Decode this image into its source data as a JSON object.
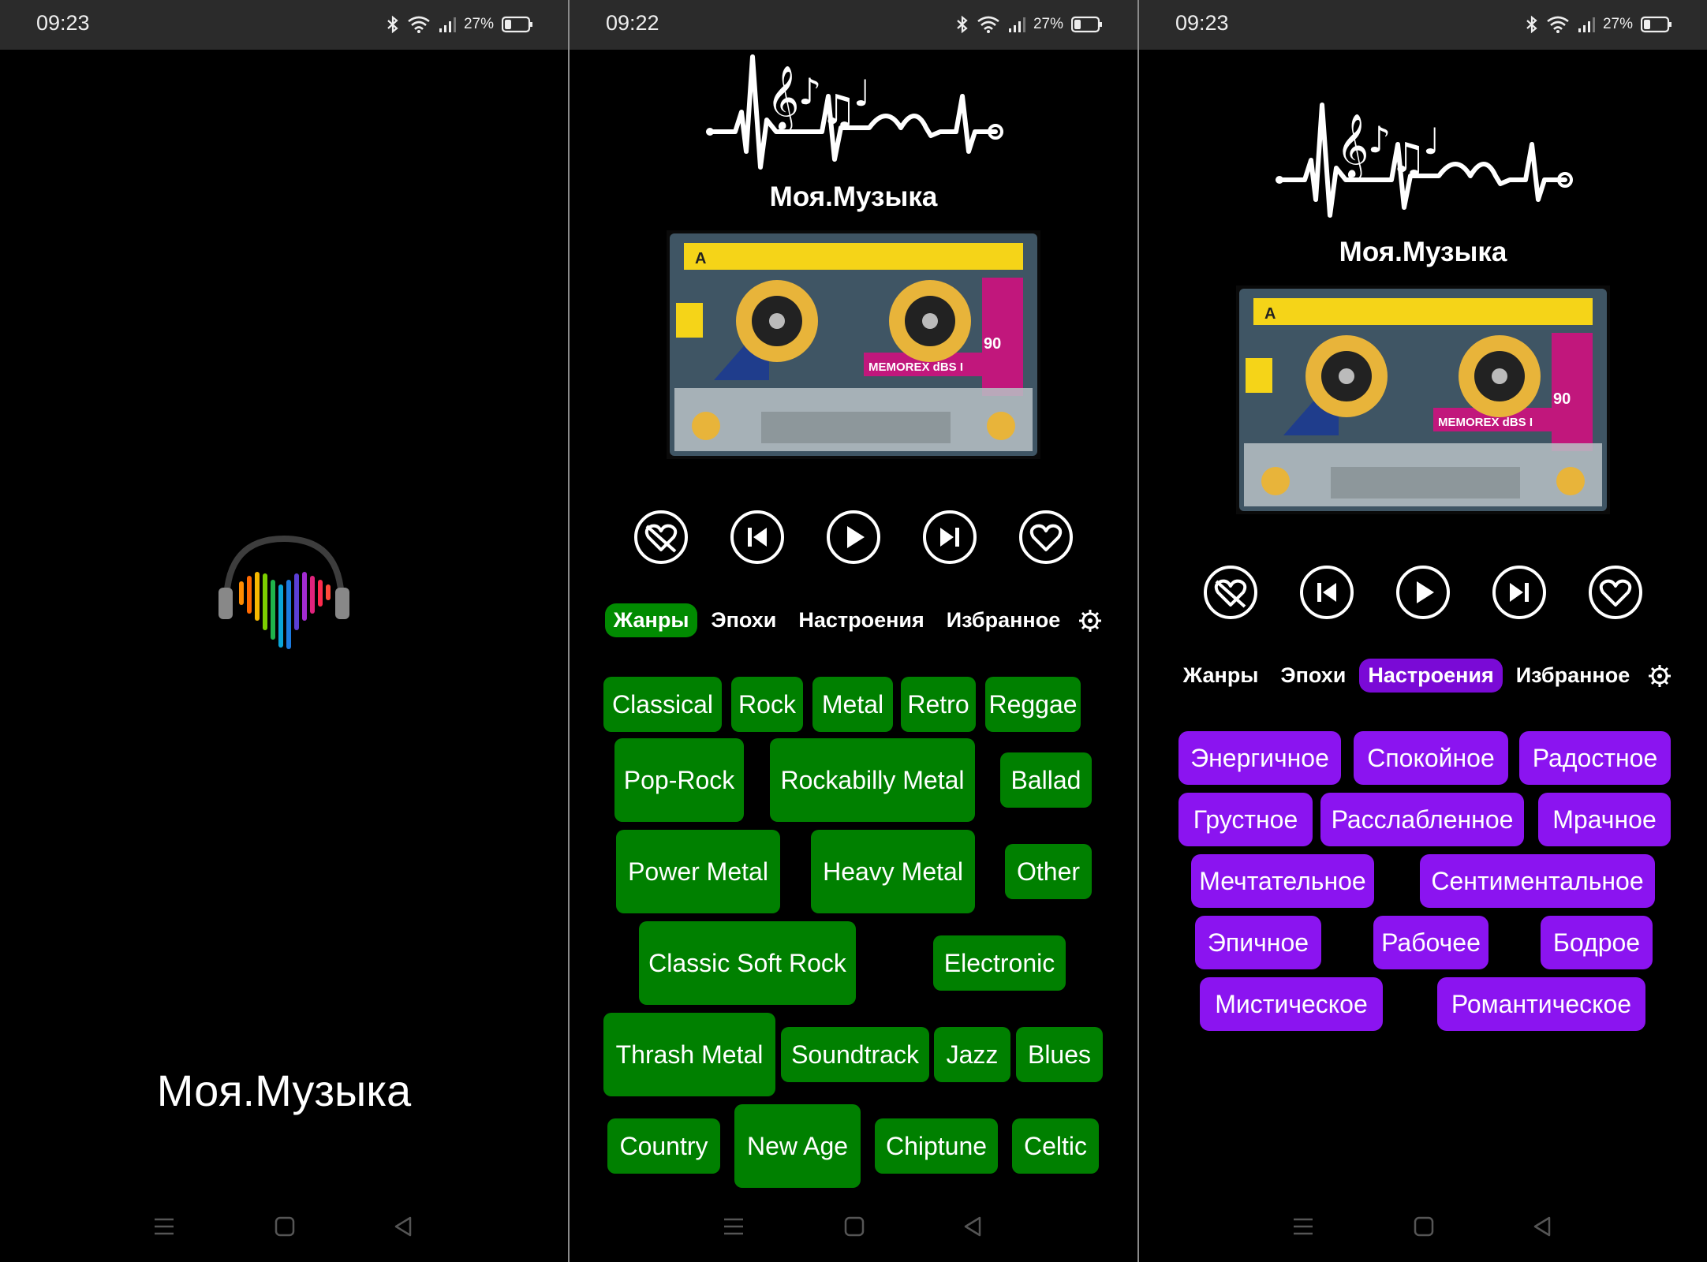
{
  "status": {
    "s1_time": "09:23",
    "s2_time": "09:22",
    "s3_time": "09:23",
    "battery": "27%"
  },
  "splash": {
    "title": "Моя.Музыка"
  },
  "app": {
    "title": "Моя.Музыка"
  },
  "tabs": {
    "genres": "Жанры",
    "eras": "Эпохи",
    "moods": "Настроения",
    "favorites": "Избранное"
  },
  "genres": [
    "Classical",
    "Rock",
    "Metal",
    "Retro",
    "Reggae",
    "Pop-Rock",
    "Rockabilly Metal",
    "Ballad",
    "Power Metal",
    "Heavy Metal",
    "Other",
    "Classic Soft Rock",
    "Electronic",
    "Thrash Metal",
    "Soundtrack",
    "Jazz",
    "Blues",
    "Country",
    "New Age",
    "Chiptune",
    "Celtic"
  ],
  "moods": [
    "Энергичное",
    "Спокойное",
    "Радостное",
    "Грустное",
    "Расслабленное",
    "Мрачное",
    "Мечтательное",
    "Сентиментальное",
    "Эпичное",
    "Рабочее",
    "Бодрое",
    "Мистическое",
    "Романтическое"
  ],
  "colors": {
    "genre_green": "#008000",
    "mood_purple": "#8b14f0",
    "status_bar": "#2b2b2b"
  },
  "cassette": {
    "side": "A",
    "length": "90",
    "brand": "MEMOREX dBS I"
  }
}
